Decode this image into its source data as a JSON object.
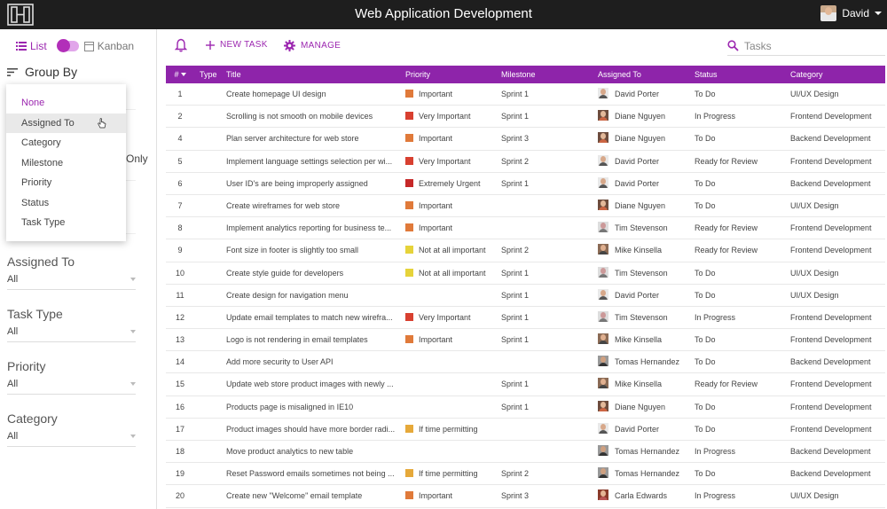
{
  "app": {
    "title": "Web Application Development",
    "user_name": "David"
  },
  "sidebar": {
    "view_list_label": "List",
    "view_kanban_label": "Kanban",
    "group_by_label": "Group By",
    "group_by_options": [
      "None",
      "Assigned To",
      "Category",
      "Milestone",
      "Priority",
      "Status",
      "Task Type"
    ],
    "group_by_selected": "None",
    "group_by_hovered": "Assigned To",
    "partial_text": "Only",
    "filters": [
      {
        "label": "Assigned To",
        "value": "All"
      },
      {
        "label": "Task Type",
        "value": "All"
      },
      {
        "label": "Priority",
        "value": "All"
      },
      {
        "label": "Category",
        "value": "All"
      }
    ]
  },
  "toolbar": {
    "new_task_label": "NEW TASK",
    "manage_label": "MANAGE",
    "search_placeholder": "Tasks"
  },
  "colors": {
    "accent": "#9c27b0",
    "header_bg": "#8e24aa",
    "flag": "#3f3fb5",
    "bug": "#e0492a",
    "chat": "#3aa55a",
    "priority": {
      "Important": "#e07a3a",
      "Very Important": "#d84030",
      "Extremely Urgent": "#c62828",
      "Not at all important": "#e6d33a",
      "If time permitting": "#e6a93a"
    }
  },
  "table": {
    "columns": [
      "#",
      "Type",
      "Title",
      "Priority",
      "Milestone",
      "Assigned To",
      "Status",
      "Category"
    ],
    "rows": [
      {
        "num": "1",
        "type": "flag-icon",
        "title": "Create homepage UI design",
        "priority": "Important",
        "milestone": "Sprint 1",
        "assignee": "David Porter",
        "avatar": "david",
        "status": "To Do",
        "category": "UI/UX Design"
      },
      {
        "num": "2",
        "type": "bug-icon",
        "title": "Scrolling is not smooth on mobile devices",
        "priority": "Very Important",
        "milestone": "Sprint 1",
        "assignee": "Diane Nguyen",
        "avatar": "diane",
        "status": "In Progress",
        "category": "Frontend Development"
      },
      {
        "num": "4",
        "type": "chat-icon",
        "title": "Plan server architecture for web store",
        "priority": "Important",
        "milestone": "Sprint 3",
        "assignee": "Diane Nguyen",
        "avatar": "diane",
        "status": "To Do",
        "category": "Backend Development"
      },
      {
        "num": "5",
        "type": "flag-icon",
        "title": "Implement language settings selection per wi...",
        "priority": "Very Important",
        "milestone": "Sprint 2",
        "assignee": "David Porter",
        "avatar": "david",
        "status": "Ready for Review",
        "category": "Frontend Development"
      },
      {
        "num": "6",
        "type": "bug-icon",
        "title": "User ID's are being improperly assigned",
        "priority": "Extremely Urgent",
        "milestone": "Sprint 1",
        "assignee": "David Porter",
        "avatar": "david",
        "status": "To Do",
        "category": "Backend Development"
      },
      {
        "num": "7",
        "type": "flag-icon",
        "title": "Create wireframes for web store",
        "priority": "Important",
        "milestone": "",
        "assignee": "Diane Nguyen",
        "avatar": "diane",
        "status": "To Do",
        "category": "UI/UX Design"
      },
      {
        "num": "8",
        "type": "flag-icon",
        "title": "Implement analytics reporting for business te...",
        "priority": "Important",
        "milestone": "",
        "assignee": "Tim Stevenson",
        "avatar": "tim",
        "status": "Ready for Review",
        "category": "Frontend Development"
      },
      {
        "num": "9",
        "type": "bug-icon",
        "title": "Font size in footer is slightly too small",
        "priority": "Not at all important",
        "milestone": "Sprint 2",
        "assignee": "Mike Kinsella",
        "avatar": "mike",
        "status": "Ready for Review",
        "category": "Frontend Development"
      },
      {
        "num": "10",
        "type": "flag-icon",
        "title": "Create style guide for developers",
        "priority": "Not at all important",
        "milestone": "Sprint 1",
        "assignee": "Tim Stevenson",
        "avatar": "tim",
        "status": "To Do",
        "category": "UI/UX Design"
      },
      {
        "num": "11",
        "type": "flag-icon",
        "title": "Create design for navigation menu",
        "priority": "",
        "milestone": "Sprint 1",
        "assignee": "David Porter",
        "avatar": "david",
        "status": "To Do",
        "category": "UI/UX Design"
      },
      {
        "num": "12",
        "type": "flag-icon",
        "title": "Update email templates to match new wirefra...",
        "priority": "Very Important",
        "milestone": "Sprint 1",
        "assignee": "Tim Stevenson",
        "avatar": "tim",
        "status": "In Progress",
        "category": "Frontend Development"
      },
      {
        "num": "13",
        "type": "bug-icon",
        "title": "Logo is not rendering in email templates",
        "priority": "Important",
        "milestone": "Sprint 1",
        "assignee": "Mike Kinsella",
        "avatar": "mike",
        "status": "To Do",
        "category": "Frontend Development"
      },
      {
        "num": "14",
        "type": "flag-icon",
        "title": "Add more security to User API",
        "priority": "",
        "milestone": "",
        "assignee": "Tomas Hernandez",
        "avatar": "tomas",
        "status": "To Do",
        "category": "Backend Development"
      },
      {
        "num": "15",
        "type": "flag-icon",
        "title": "Update web store product images with newly ...",
        "priority": "",
        "milestone": "Sprint 1",
        "assignee": "Mike Kinsella",
        "avatar": "mike",
        "status": "Ready for Review",
        "category": "Frontend Development"
      },
      {
        "num": "16",
        "type": "bug-icon",
        "title": "Products page is misaligned in IE10",
        "priority": "",
        "milestone": "Sprint 1",
        "assignee": "Diane Nguyen",
        "avatar": "diane",
        "status": "To Do",
        "category": "Frontend Development"
      },
      {
        "num": "17",
        "type": "flag-icon",
        "title": "Product images should have more border radi...",
        "priority": "If time permitting",
        "milestone": "",
        "assignee": "David Porter",
        "avatar": "david",
        "status": "To Do",
        "category": "Frontend Development"
      },
      {
        "num": "18",
        "type": "flag-icon",
        "title": "Move product analytics to new table",
        "priority": "",
        "milestone": "",
        "assignee": "Tomas Hernandez",
        "avatar": "tomas",
        "status": "In Progress",
        "category": "Backend Development"
      },
      {
        "num": "19",
        "type": "bug-icon",
        "title": "Reset Password emails sometimes not being ...",
        "priority": "If time permitting",
        "milestone": "Sprint 2",
        "assignee": "Tomas Hernandez",
        "avatar": "tomas",
        "status": "To Do",
        "category": "Backend Development"
      },
      {
        "num": "20",
        "type": "flag-icon",
        "title": "Create new \"Welcome\" email template",
        "priority": "Important",
        "milestone": "Sprint 3",
        "assignee": "Carla Edwards",
        "avatar": "carla",
        "status": "In Progress",
        "category": "UI/UX Design"
      }
    ]
  }
}
